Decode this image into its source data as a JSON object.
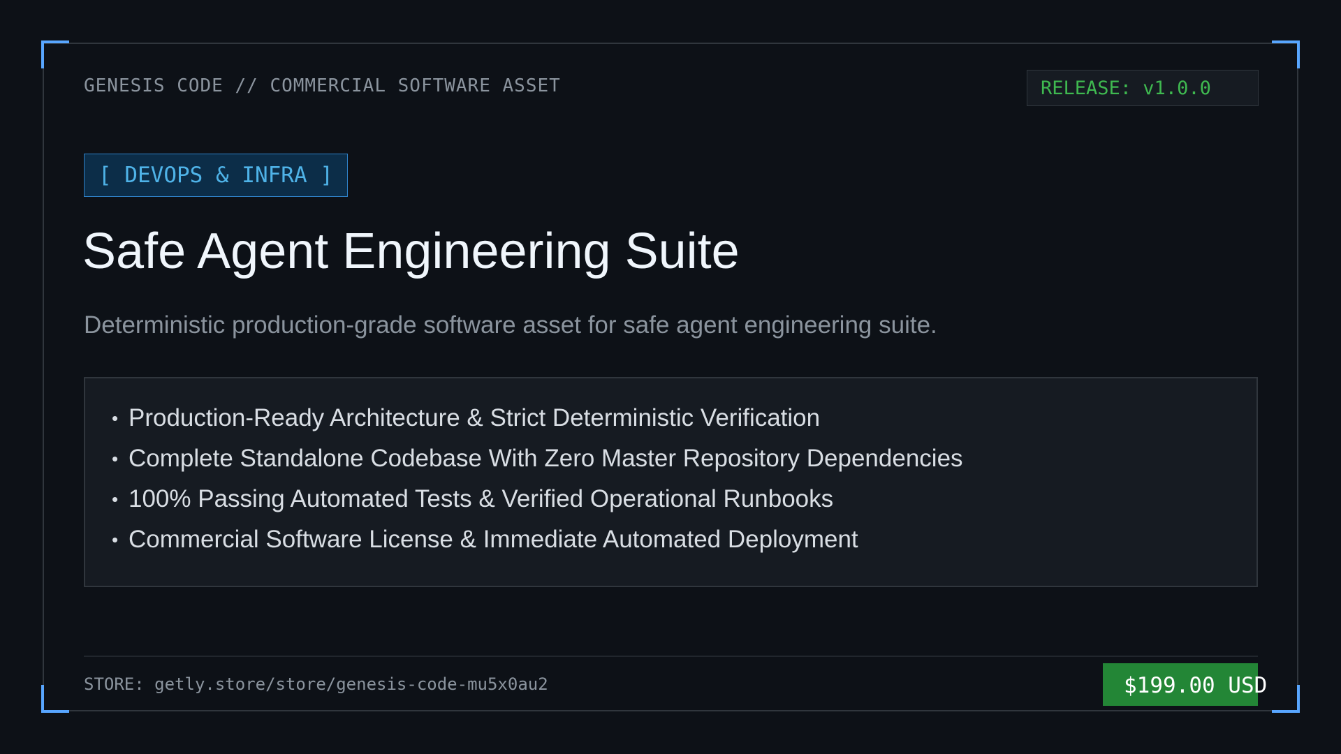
{
  "header": {
    "eyebrow": "GENESIS CODE // COMMERCIAL SOFTWARE ASSET",
    "release": "RELEASE: v1.0.0"
  },
  "product": {
    "category": "[ DEVOPS & INFRA ]",
    "title": "Safe Agent Engineering Suite",
    "subtitle": "Deterministic production-grade software asset for safe agent engineering suite."
  },
  "features": [
    "Production-Ready Architecture & Strict Deterministic Verification",
    "Complete Standalone Codebase With Zero Master Repository Dependencies",
    "100% Passing Automated Tests & Verified Operational Runbooks",
    "Commercial Software License & Immediate Automated Deployment"
  ],
  "bullet": "•",
  "footer": {
    "store": "STORE: getly.store/store/genesis-code-mu5x0au2",
    "price": "$199.00 USD"
  },
  "colors": {
    "background": "#0d1117",
    "accent_corner": "#58a6ff",
    "release_text": "#3fb950",
    "category_text": "#4fb3e8",
    "price_background": "#238636"
  }
}
